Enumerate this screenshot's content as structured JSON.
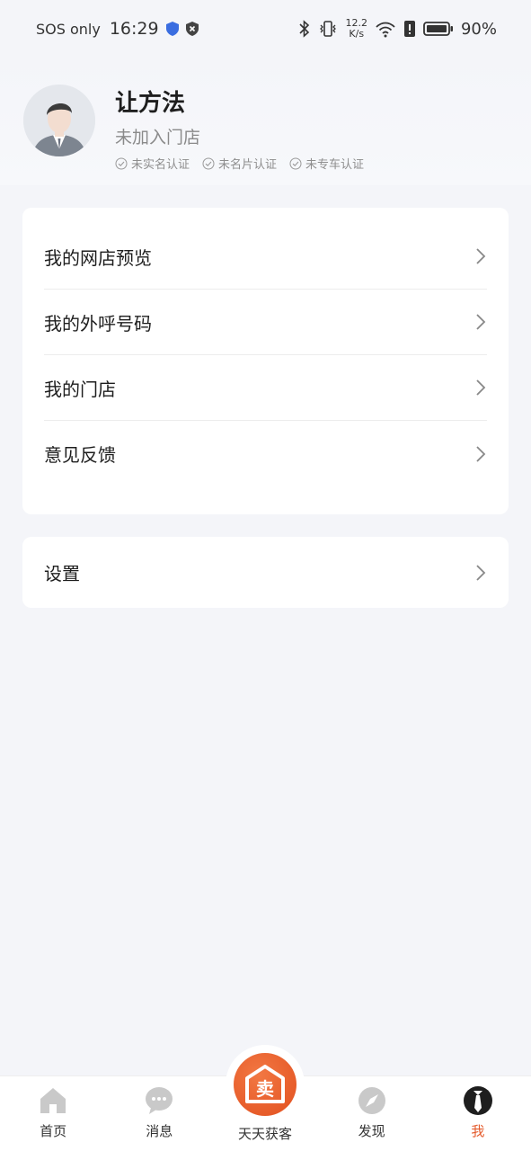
{
  "status_bar": {
    "sos": "SOS only",
    "time": "16:29",
    "speed_value": "12.2",
    "speed_unit": "K/s",
    "battery": "90%"
  },
  "profile": {
    "name": "让方法",
    "store_status": "未加入门店",
    "badges": [
      "未实名认证",
      "未名片认证",
      "未专车认证"
    ]
  },
  "menu": {
    "items": [
      "我的网店预览",
      "我的外呼号码",
      "我的门店",
      "意见反馈"
    ],
    "settings": "设置"
  },
  "bottom_nav": {
    "home": "首页",
    "messages": "消息",
    "center": "天天获客",
    "discover": "发现",
    "me": "我",
    "active_color": "#e45a2b",
    "center_icon_char": "卖"
  }
}
